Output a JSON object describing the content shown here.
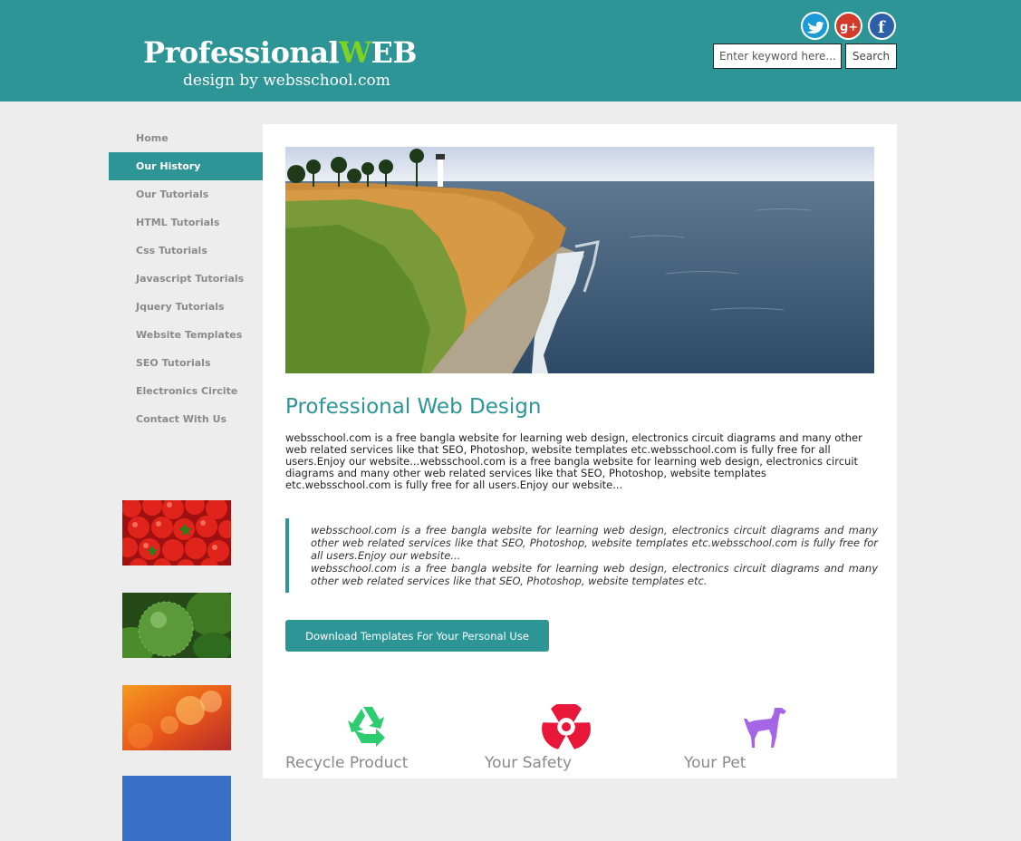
{
  "header": {
    "logo": {
      "main_prefix": "Professional",
      "main_accent": "W",
      "main_suffix": "EB",
      "sub": "design by websschool.com"
    },
    "social": [
      {
        "icon": "twitter-icon",
        "color": "#1a9bd7"
      },
      {
        "icon": "google-plus-icon",
        "color": "#d23a2a"
      },
      {
        "icon": "facebook-icon",
        "color": "#2d5fa8"
      }
    ],
    "search": {
      "placeholder": "Enter keyword here...",
      "button_label": "Search"
    }
  },
  "sidebar": {
    "items": [
      {
        "label": "Home"
      },
      {
        "label": "Our History",
        "active": true
      },
      {
        "label": "Our Tutorials"
      },
      {
        "label": "HTML Tutorials"
      },
      {
        "label": "Css Tutorials"
      },
      {
        "label": "Javascript Tutorials"
      },
      {
        "label": "Jquery Tutorials"
      },
      {
        "label": "Website Templates"
      },
      {
        "label": "SEO Tutorials"
      },
      {
        "label": "Electronics Circite"
      },
      {
        "label": "Contact With Us"
      }
    ],
    "thumbnails": [
      "tomatoes",
      "limes",
      "orange-bokeh",
      "blue"
    ]
  },
  "main": {
    "title": "Professional Web Design",
    "intro": "websschool.com is a free bangla website for learning web design, electronics circuit diagrams and many other web related services like that SEO, Photoshop, website templates etc.websschool.com is fully free for all users.Enjoy our website...websschool.com is a free bangla website for learning web design, electronics circuit diagrams and many other web related services like that SEO, Photoshop, website templates etc.websschool.com is fully free for all users.Enjoy our website...",
    "quote": {
      "p1": "websschool.com is a free bangla website for learning web design, electronics circuit diagrams and many other web related services like that SEO, Photoshop, website templates etc.websschool.com is fully free for all users.Enjoy our website...",
      "p2": "websschool.com is a free bangla website for learning web design, electronics circuit diagrams and many other web related services like that SEO, Photoshop, website templates etc."
    },
    "cta_label": "Download Templates For Your Personal Use",
    "features": [
      {
        "label": "Recycle Product",
        "icon": "recycle-icon",
        "color": "#2ecc71"
      },
      {
        "label": "Your Safety",
        "icon": "radiation-icon",
        "color": "#e8173a"
      },
      {
        "label": "Your Pet",
        "icon": "dog-icon",
        "color": "#a566e6"
      }
    ]
  },
  "colors": {
    "accent": "#2e9597",
    "background": "#ededed",
    "logo_accent": "#7ed321"
  }
}
